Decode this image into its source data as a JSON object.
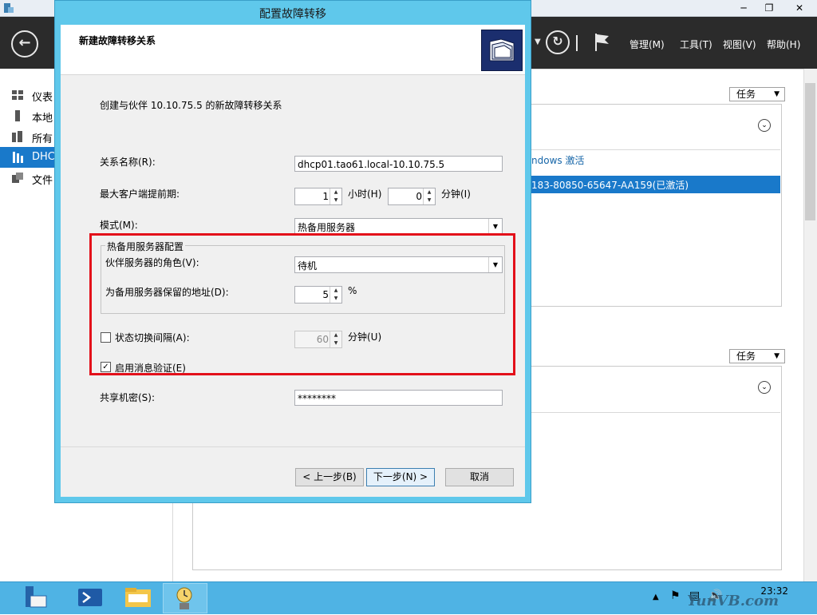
{
  "server_manager": {
    "window_controls": {
      "minimize": "─",
      "restore": "❐",
      "close": "✕"
    },
    "menu": [
      "管理(M)",
      "工具(T)",
      "视图(V)",
      "帮助(H)"
    ],
    "sidebar": [
      "仪表",
      "本地",
      "所有",
      "DHC",
      "文件"
    ],
    "tasks_label": "任务",
    "panel_text_1": "ndows 激活",
    "panel_text_2": "183-80850-65647-AA159(已激活)"
  },
  "dialog": {
    "title": "配置故障转移",
    "header_title": "新建故障转移关系",
    "intro": "创建与伙伴 10.10.75.5 的新故障转移关系",
    "relationship_name_label": "关系名称(R):",
    "relationship_name_value": "dhcp01.tao61.local-10.10.75.5",
    "mclt_label": "最大客户端提前期:",
    "mclt_hours": "1",
    "hours_label": "小时(H)",
    "mclt_minutes": "0",
    "minutes_label": "分钟(I)",
    "mode_label": "模式(M):",
    "mode_value": "热备用服务器",
    "hot_standby_group": "热备用服务器配置",
    "partner_role_label": "伙伴服务器的角色(V):",
    "partner_role_value": "待机",
    "reserve_label": "为备用服务器保留的地址(D):",
    "reserve_value": "5",
    "percent": "%",
    "state_switch_label": "状态切换间隔(A):",
    "state_switch_checked": false,
    "state_switch_value": "60",
    "state_switch_unit": "分钟(U)",
    "auth_label": "启用消息验证(E)",
    "auth_checked": true,
    "secret_label": "共享机密(S):",
    "secret_value": "********",
    "back_button": "< 上一步(B)",
    "next_button": "下一步(N) >",
    "cancel_button": "取消"
  },
  "taskbar": {
    "time": "23:32",
    "date": "",
    "watermark": "YunVB.com"
  },
  "colors": {
    "dialog_frame": "#5fc8eb",
    "highlight_box": "#e3101a",
    "selection": "#1979ca",
    "taskbar": "#4fb3e4",
    "toolbar": "#2b2b2b"
  }
}
